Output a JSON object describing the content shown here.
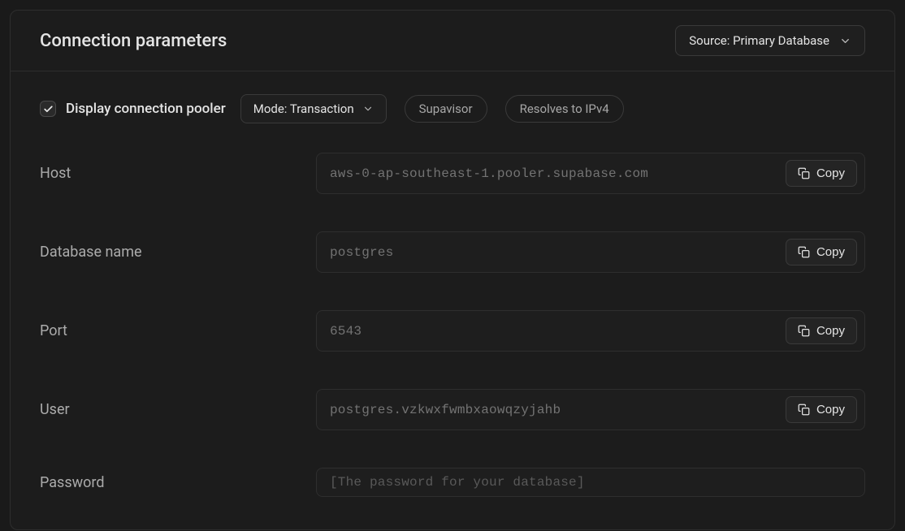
{
  "header": {
    "title": "Connection parameters",
    "source_select_label": "Source: Primary Database"
  },
  "options": {
    "display_pooler_label": "Display connection pooler",
    "mode_select_label": "Mode: Transaction",
    "chips": [
      "Supavisor",
      "Resolves to IPv4"
    ]
  },
  "labels": {
    "copy": "Copy"
  },
  "fields": [
    {
      "label": "Host",
      "value": "aws-0-ap-southeast-1.pooler.supabase.com",
      "copy": true
    },
    {
      "label": "Database name",
      "value": "postgres",
      "copy": true
    },
    {
      "label": "Port",
      "value": "6543",
      "copy": true
    },
    {
      "label": "User",
      "value": "postgres.vzkwxfwmbxaowqzyjahb",
      "copy": true
    },
    {
      "label": "Password",
      "value": "",
      "placeholder": "[The password for your database]",
      "copy": false
    }
  ]
}
